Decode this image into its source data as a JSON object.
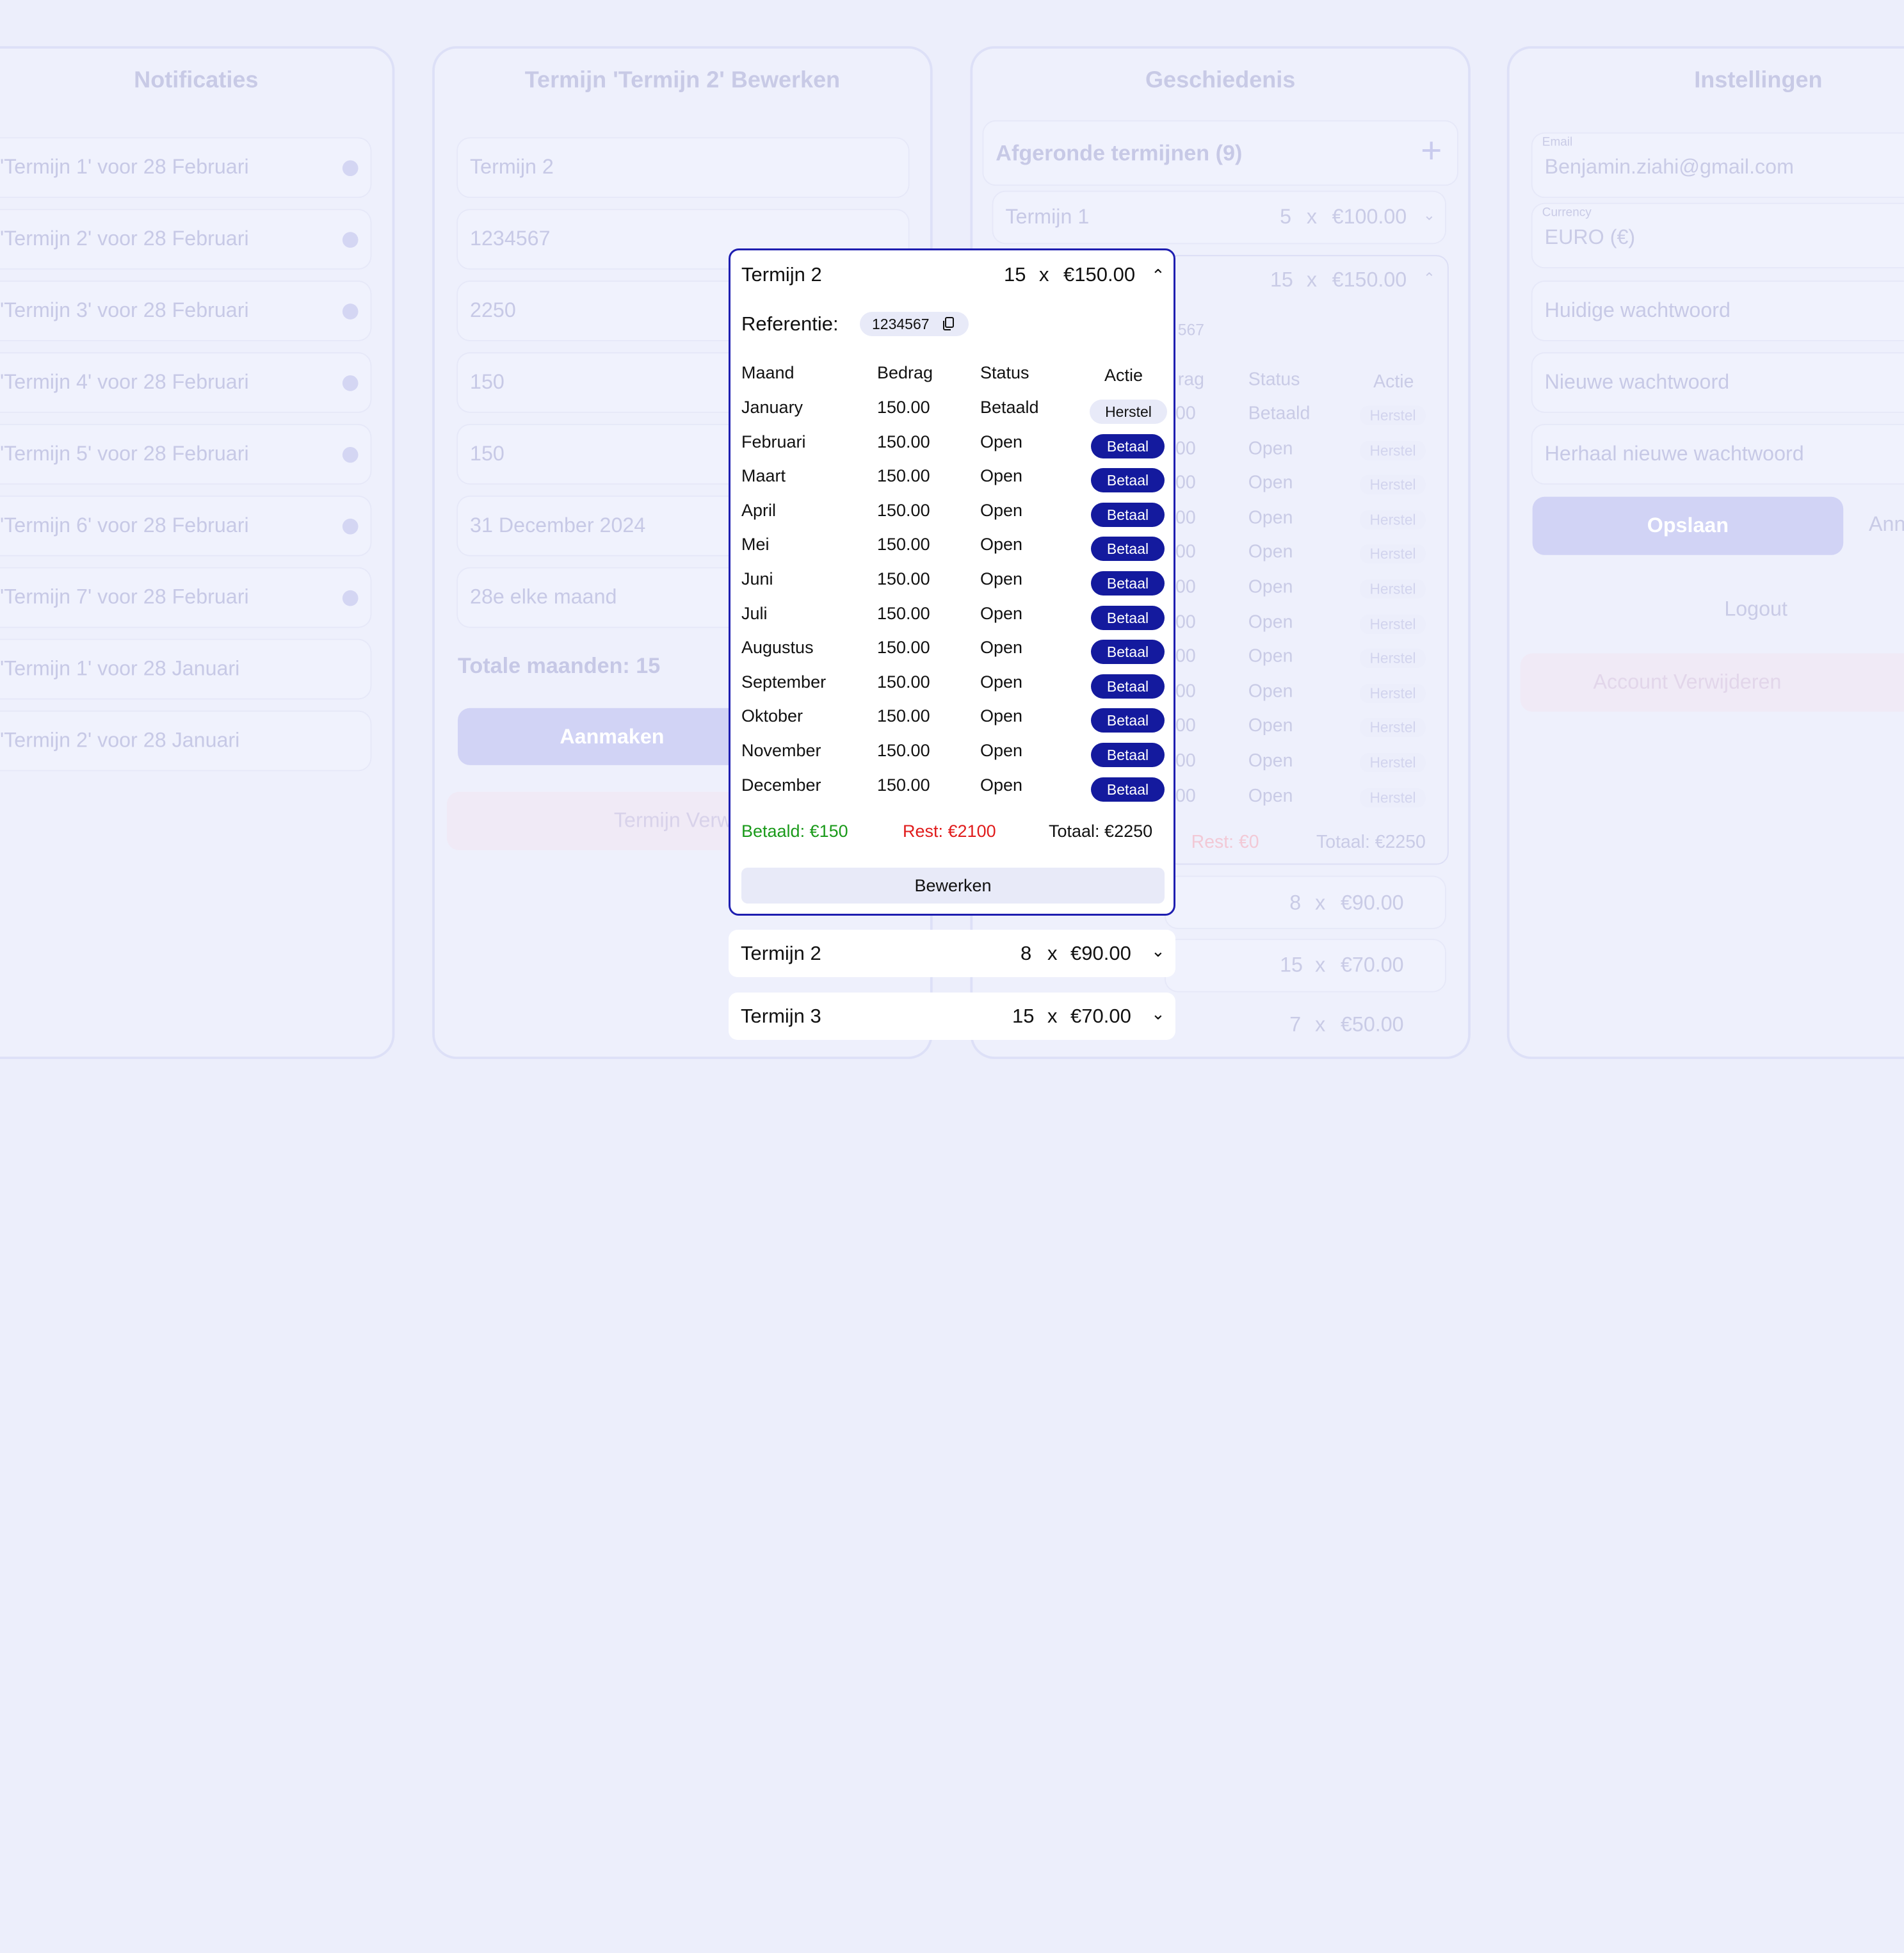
{
  "notifications": {
    "title": "Notificaties",
    "items": [
      {
        "label": "'Termijn 1' voor 28 Februari",
        "unread": true
      },
      {
        "label": "'Termijn 2' voor 28 Februari",
        "unread": true
      },
      {
        "label": "'Termijn 3' voor 28 Februari",
        "unread": true
      },
      {
        "label": "'Termijn 4' voor 28 Februari",
        "unread": true
      },
      {
        "label": "'Termijn 5' voor 28 Februari",
        "unread": true
      },
      {
        "label": "'Termijn 6' voor 28 Februari",
        "unread": true
      },
      {
        "label": "'Termijn 7' voor 28 Februari",
        "unread": true
      },
      {
        "label": "'Termijn 1' voor 28 Januari",
        "unread": false
      },
      {
        "label": "'Termijn 2' voor 28 Januari",
        "unread": false
      }
    ]
  },
  "edit": {
    "title": "Termijn 'Termijn 2' Bewerken",
    "fields": [
      "Termijn 2",
      "1234567",
      "2250",
      "150",
      "150",
      "31 December 2024",
      "28e elke maand"
    ],
    "total_months": "Totale maanden: 15",
    "create_label": "Aanmaken",
    "delete_label": "Termijn Verwij"
  },
  "history": {
    "title": "Geschiedenis",
    "completed_header": "Afgeronde termijnen (9)",
    "add_icon": "plus-icon",
    "row1": {
      "name": "Termijn 1",
      "count": "5",
      "x": "x",
      "amount": "€100.00"
    },
    "row2": {
      "count": "15",
      "x": "x",
      "amount": "€150.00",
      "ref": "567"
    },
    "table_head": {
      "bedrag": "rag",
      "status": "Status",
      "actie": "Actie"
    },
    "rows": [
      {
        "amount": "00",
        "status": "Betaald",
        "action": "Herstel"
      },
      {
        "amount": "00",
        "status": "Open",
        "action": "Herstel"
      },
      {
        "amount": "00",
        "status": "Open",
        "action": "Herstel"
      },
      {
        "amount": "00",
        "status": "Open",
        "action": "Herstel"
      },
      {
        "amount": "00",
        "status": "Open",
        "action": "Herstel"
      },
      {
        "amount": "00",
        "status": "Open",
        "action": "Herstel"
      },
      {
        "amount": "00",
        "status": "Open",
        "action": "Herstel"
      },
      {
        "amount": "00",
        "status": "Open",
        "action": "Herstel"
      },
      {
        "amount": "00",
        "status": "Open",
        "action": "Herstel"
      },
      {
        "amount": "00",
        "status": "Open",
        "action": "Herstel"
      },
      {
        "amount": "00",
        "status": "Open",
        "action": "Herstel"
      },
      {
        "amount": "00",
        "status": "Open",
        "action": "Herstel"
      }
    ],
    "rest": "Rest: €0",
    "total": "Totaal: €2250",
    "lower_rows": [
      {
        "count": "8",
        "x": "x",
        "amount": "€90.00"
      },
      {
        "count": "15",
        "x": "x",
        "amount": "€70.00"
      },
      {
        "count": "7",
        "x": "x",
        "amount": "€50.00"
      }
    ]
  },
  "settings": {
    "title": "Instellingen",
    "email_label": "Email",
    "email_value": "Benjamin.ziahi@gmail.com",
    "currency_label": "Currency",
    "currency_value": "EURO (€)",
    "current_password_placeholder": "Huidige wachtwoord",
    "new_password_placeholder": "Nieuwe wachtwoord",
    "repeat_password_placeholder": "Herhaal nieuwe wachtwoord",
    "save_label": "Opslaan",
    "cancel_label": "Ann",
    "logout_label": "Logout",
    "delete_account_label": "Account Verwijderen"
  },
  "popup": {
    "name": "Termijn 2",
    "count": "15",
    "x": "x",
    "amount": "€150.00",
    "ref_label": "Referentie:",
    "ref_value": "1234567",
    "columns": {
      "month": "Maand",
      "amount": "Bedrag",
      "status": "Status",
      "action": "Actie"
    },
    "rows": [
      {
        "month": "January",
        "amount": "150.00",
        "status": "Betaald",
        "action": "Herstel"
      },
      {
        "month": "Februari",
        "amount": "150.00",
        "status": "Open",
        "action": "Betaal"
      },
      {
        "month": "Maart",
        "amount": "150.00",
        "status": "Open",
        "action": "Betaal"
      },
      {
        "month": "April",
        "amount": "150.00",
        "status": "Open",
        "action": "Betaal"
      },
      {
        "month": "Mei",
        "amount": "150.00",
        "status": "Open",
        "action": "Betaal"
      },
      {
        "month": "Juni",
        "amount": "150.00",
        "status": "Open",
        "action": "Betaal"
      },
      {
        "month": "Juli",
        "amount": "150.00",
        "status": "Open",
        "action": "Betaal"
      },
      {
        "month": "Augustus",
        "amount": "150.00",
        "status": "Open",
        "action": "Betaal"
      },
      {
        "month": "September",
        "amount": "150.00",
        "status": "Open",
        "action": "Betaal"
      },
      {
        "month": "Oktober",
        "amount": "150.00",
        "status": "Open",
        "action": "Betaal"
      },
      {
        "month": "November",
        "amount": "150.00",
        "status": "Open",
        "action": "Betaal"
      },
      {
        "month": "December",
        "amount": "150.00",
        "status": "Open",
        "action": "Betaal"
      }
    ],
    "paid": "Betaald: €150",
    "rest": "Rest: €2100",
    "total": "Totaal: €2250",
    "edit_label": "Bewerken"
  },
  "below_popup": [
    {
      "name": "Termijn 2",
      "count": "8",
      "x": "x",
      "amount": "€90.00"
    },
    {
      "name": "Termijn 3",
      "count": "15",
      "x": "x",
      "amount": "€70.00"
    }
  ],
  "colors": {
    "accent": "#141a9e",
    "paid": "#1a9a1a",
    "rest": "#e01b1b",
    "background": "#eceefb"
  }
}
